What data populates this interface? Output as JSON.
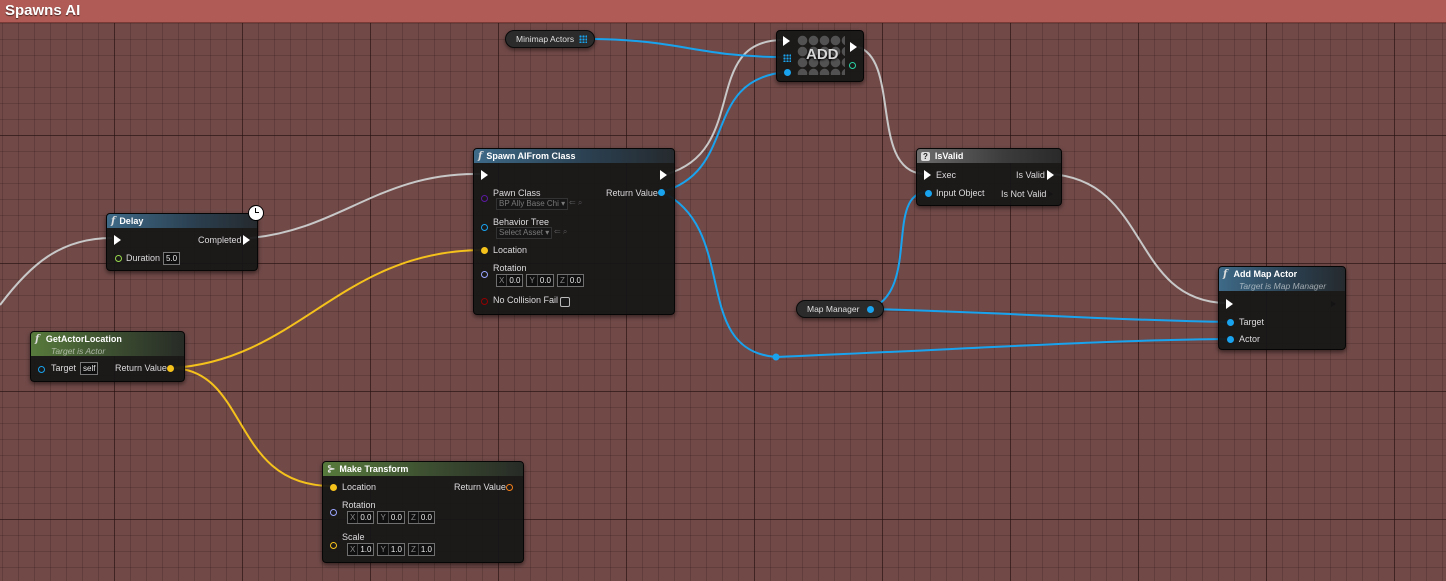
{
  "window": {
    "title": "Spawns AI"
  },
  "colors": {
    "exec": "#ffffff",
    "object": "#19a3ee",
    "vector": "#f5c21c",
    "rotator": "#9aa6ff",
    "float": "#97d94d",
    "bool": "#920101",
    "transform": "#f27f1a",
    "class": "#5a1aa0"
  },
  "nodes": {
    "minimap_actors": {
      "label": "Minimap Actors"
    },
    "add": {
      "label": "ADD"
    },
    "spawn_ai": {
      "title": "Spawn AIFrom Class",
      "pawn_class": "Pawn Class",
      "pawn_class_value": "BP Ally Base Chi",
      "behavior_tree": "Behavior Tree",
      "behavior_tree_value": "Select Asset",
      "location": "Location",
      "rotation": "Rotation",
      "rot_x": "0.0",
      "rot_y": "0.0",
      "rot_z": "0.0",
      "no_collision_fail": "No Collision Fail",
      "return_value": "Return Value"
    },
    "is_valid": {
      "title": "IsValid",
      "exec": "Exec",
      "input_object": "Input Object",
      "is_valid": "Is Valid",
      "is_not_valid": "Is Not Valid"
    },
    "delay": {
      "title": "Delay",
      "duration": "Duration",
      "duration_value": "5.0",
      "completed": "Completed"
    },
    "get_actor_location": {
      "title": "GetActorLocation",
      "subtitle": "Target is Actor",
      "target": "Target",
      "target_value": "self",
      "return_value": "Return Value"
    },
    "map_manager": {
      "label": "Map Manager"
    },
    "add_map_actor": {
      "title": "Add Map Actor",
      "subtitle": "Target is Map Manager",
      "target": "Target",
      "actor": "Actor"
    },
    "make_transform": {
      "title": "Make Transform",
      "location": "Location",
      "rotation": "Rotation",
      "scale": "Scale",
      "return_value": "Return Value",
      "rot_x": "0.0",
      "rot_y": "0.0",
      "rot_z": "0.0",
      "scale_x": "1.0",
      "scale_y": "1.0",
      "scale_z": "1.0"
    }
  },
  "axis_labels": {
    "x": "X",
    "y": "Y",
    "z": "Z"
  }
}
